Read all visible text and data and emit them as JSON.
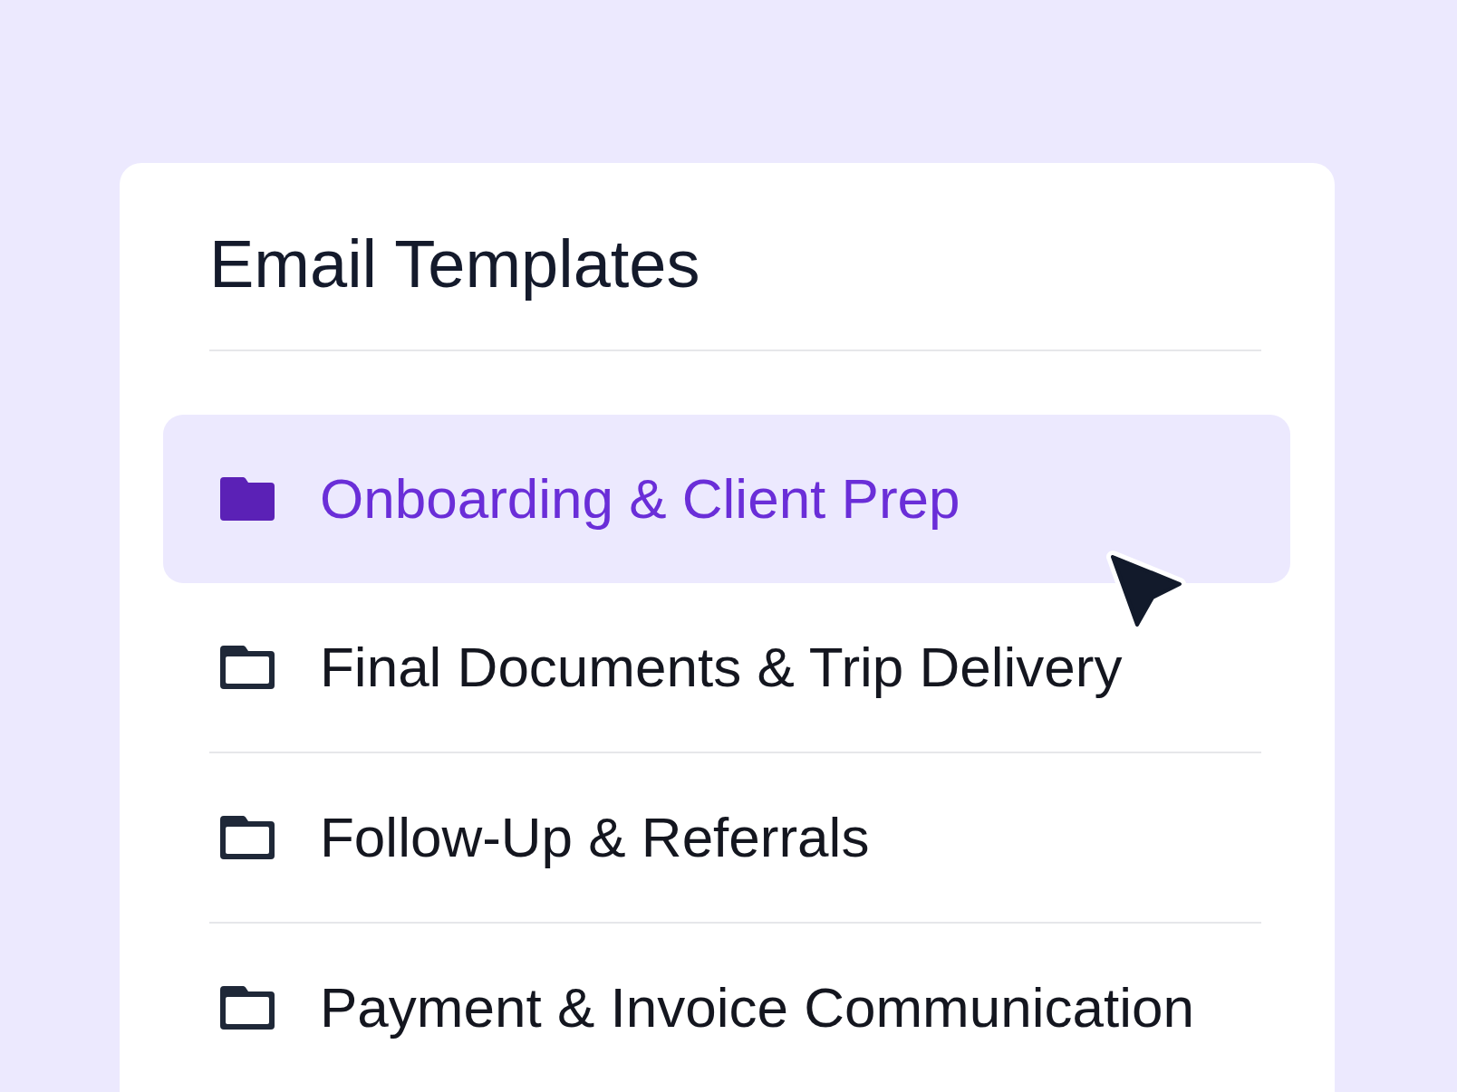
{
  "title": "Email Templates",
  "folders": [
    {
      "label": "Onboarding & Client Prep",
      "selected": true
    },
    {
      "label": "Final Documents & Trip Delivery",
      "selected": false
    },
    {
      "label": "Follow-Up & Referrals",
      "selected": false
    },
    {
      "label": "Payment & Invoice Communication",
      "selected": false
    }
  ]
}
